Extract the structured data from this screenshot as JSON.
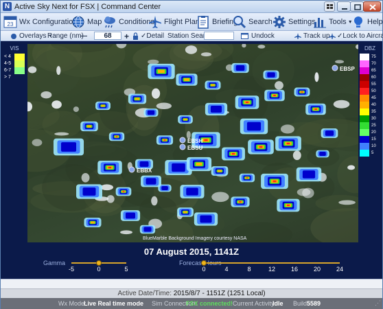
{
  "window": {
    "title": "Active Sky Next for FSX | Command Center",
    "app_icon_letter": "N"
  },
  "toolbar": {
    "wx_config": "Wx Configuration",
    "wx_config_day": "23",
    "map": "Map",
    "conditions": "Conditions",
    "flight_plan": "Flight Plan",
    "briefing": "Briefing",
    "search": "Search",
    "settings": "Settings",
    "tools": "Tools",
    "help": "Help"
  },
  "subbar": {
    "overlays": "Overlays",
    "range_label": "Range (nm)",
    "range_minus": "—",
    "range_value": "68",
    "range_plus": "+",
    "detail": "Detail",
    "station_search": "Station Search",
    "undock": "Undock",
    "track_up": "Track up",
    "lock_aircraft": "Lock to Aircraft"
  },
  "map": {
    "stations": [
      {
        "id": "EBSP"
      },
      {
        "id": "EBSH"
      },
      {
        "id": "EBSU"
      },
      {
        "id": "EBBX"
      }
    ],
    "credit": "BlueMarble Background Imagery courtesy NASA"
  },
  "vis_legend": {
    "title": "VIS",
    "items": [
      {
        "label": "< 4",
        "color": "#ffff33"
      },
      {
        "label": "4-5",
        "color": "#d8ff55"
      },
      {
        "label": "6-7",
        "color": "#88ff88"
      },
      {
        "label": "> 7",
        "color": "#0b1a4a"
      }
    ]
  },
  "dbz_legend": {
    "title": "DBZ",
    "items": [
      {
        "label": "75",
        "color": "#ffffff"
      },
      {
        "label": "70",
        "color": "#ff66ff"
      },
      {
        "label": "65",
        "color": "#e000d0"
      },
      {
        "label": "60",
        "color": "#9c0000"
      },
      {
        "label": "55",
        "color": "#cc0000"
      },
      {
        "label": "50",
        "color": "#ff2020"
      },
      {
        "label": "45",
        "color": "#ff8c00"
      },
      {
        "label": "40",
        "color": "#ffb000"
      },
      {
        "label": "35",
        "color": "#ffff00"
      },
      {
        "label": "30",
        "color": "#00a000"
      },
      {
        "label": "25",
        "color": "#33dd33"
      },
      {
        "label": "20",
        "color": "#66ff66"
      },
      {
        "label": "15",
        "color": "#0000cc"
      },
      {
        "label": "10",
        "color": "#4080ff"
      },
      {
        "label": "5",
        "color": "#00ffff"
      }
    ]
  },
  "date_display": "07 August 2015, 1141Z",
  "gamma": {
    "label": "Gamma",
    "ticks": [
      "-5",
      "0",
      "5"
    ],
    "value": 0
  },
  "forecast": {
    "label": "Forecast Hours",
    "ticks": [
      "0",
      "4",
      "8",
      "12",
      "16",
      "20",
      "24"
    ],
    "value": 0
  },
  "active_bar": {
    "label": "Active Date/Time:",
    "value": "2015/8/7 - 1151Z (1251 Local)"
  },
  "status": {
    "wx_mode_label": "Wx Mode:",
    "wx_mode_value": "Live Real time mode",
    "sim_label": "Sim Connection:",
    "sim_value": "FSX connected!",
    "activity_label": "Current Activity:",
    "activity_value": "Idle",
    "build_label": "Build:",
    "build_value": "5589"
  }
}
